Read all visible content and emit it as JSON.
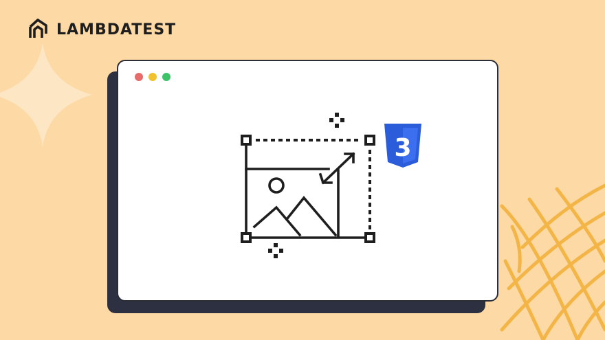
{
  "brand": {
    "name": "LAMBDATEST",
    "logo_icon": "lambdatest-logo-icon"
  },
  "window": {
    "controls": [
      "close-dot",
      "minimize-dot",
      "maximize-dot"
    ],
    "control_colors": [
      "#e86b6b",
      "#f2c12e",
      "#3dc46b"
    ]
  },
  "illustration": {
    "icon": "resize-image-icon",
    "badge": "css3-logo-icon",
    "badge_text": "3"
  },
  "colors": {
    "background": "#fdd9a5",
    "window": "#ffffff",
    "window_shadow": "#2d3040",
    "accent_lines": "#f4b547",
    "sparkle": "#fde6c3",
    "css_blue": "#2b5cd9"
  }
}
